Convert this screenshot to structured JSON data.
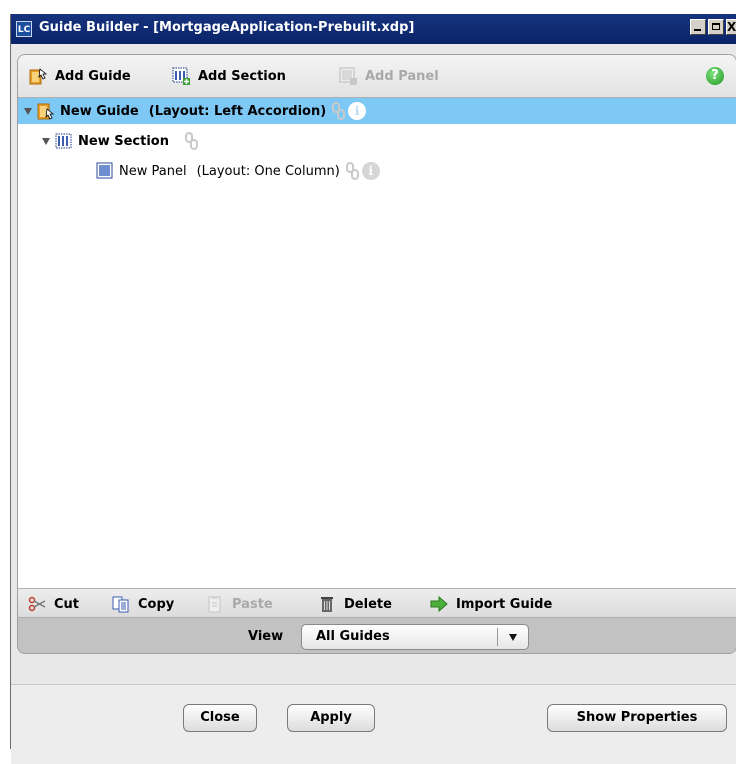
{
  "window": {
    "app_icon_text": "LC",
    "title": "Guide Builder - [MortgageApplication-Prebuilt.xdp]",
    "close_glyph": "X"
  },
  "toolbar": {
    "add_guide": "Add Guide",
    "add_section": "Add Section",
    "add_panel": "Add Panel",
    "help_glyph": "?"
  },
  "tree": {
    "guide": {
      "name": "New Guide",
      "layout": "(Layout: Left Accordion)"
    },
    "section": {
      "name": "New Section"
    },
    "panel": {
      "name": "New Panel",
      "layout": "(Layout: One Column)"
    },
    "info_glyph": "i"
  },
  "actions": {
    "cut": "Cut",
    "copy": "Copy",
    "paste": "Paste",
    "delete": "Delete",
    "import_guide": "Import Guide"
  },
  "view": {
    "label": "View",
    "selected": "All Guides"
  },
  "buttons": {
    "close": "Close",
    "apply": "Apply",
    "show_properties": "Show Properties"
  },
  "colors": {
    "selection": "#7dc8f5",
    "titlebar": "#0a246a",
    "help": "#1f9a1f"
  }
}
